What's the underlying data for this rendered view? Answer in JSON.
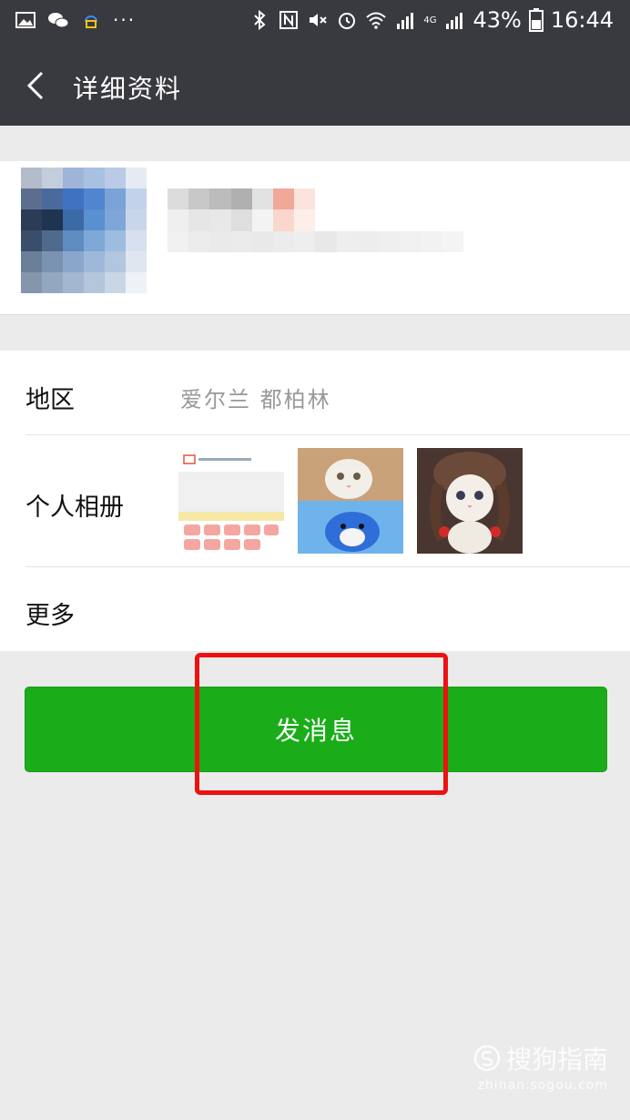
{
  "status_bar": {
    "battery_percent": "43%",
    "time": "16:44",
    "network": "4G",
    "icons_left": [
      "gallery-icon",
      "wechat-icon",
      "qq-icon",
      "more-icon"
    ],
    "icons_right": [
      "bluetooth-icon",
      "nfc-icon",
      "mute-icon",
      "alarm-icon",
      "wifi-icon",
      "signal-icon",
      "signal-4g-icon",
      "battery-icon"
    ]
  },
  "header": {
    "title": "详细资料",
    "back_icon": "back-arrow-icon"
  },
  "profile": {
    "avatar_blurred": true,
    "name_blurred": true
  },
  "info_rows": {
    "region_label": "地区",
    "region_value": "爱尔兰  都柏林",
    "album_label": "个人相册",
    "more_label": "更多"
  },
  "album_photos": [
    "app-screenshot-thumbnail",
    "cat-and-blue-toy-thumbnail",
    "cat-with-wig-thumbnail"
  ],
  "actions": {
    "send_message_label": "发消息"
  },
  "annotation": {
    "highlight_color": "#ee1111"
  },
  "watermark": {
    "brand": "搜狗指南",
    "url": "zhinan.sogou.com"
  },
  "colors": {
    "header_bg": "#393a3f",
    "primary_button": "#1aad19",
    "page_bg": "#ebebeb"
  }
}
